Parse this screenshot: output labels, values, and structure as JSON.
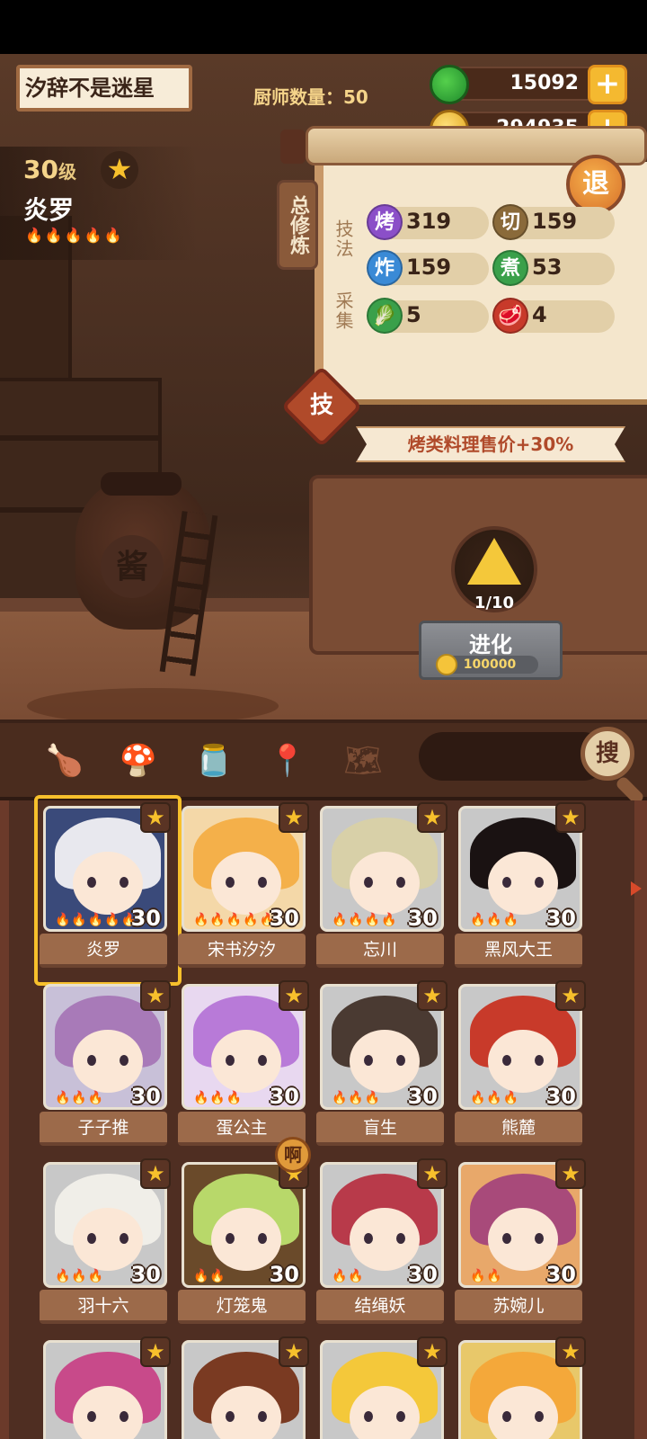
{
  "header": {
    "player_name": "汐辞不是迷星",
    "chef_count_label": "厨师数量：",
    "chef_count_value": "50",
    "jade": "15092",
    "coins": "294935",
    "plus_label": "+"
  },
  "chef": {
    "level": "30",
    "level_suffix": "级",
    "star": "★",
    "name": "炎罗",
    "flames": "🔥🔥🔥🔥🔥"
  },
  "skills": {
    "tab_label": "总修炼",
    "exit_label": "退",
    "technique_label": "技法",
    "gather_label": "采集",
    "items": [
      {
        "badge": "烤",
        "value": "319",
        "color": "#8b4fc8"
      },
      {
        "badge": "切",
        "value": "159",
        "color": "#8a6a3a"
      },
      {
        "badge": "炸",
        "value": "159",
        "color": "#3a8ad6"
      },
      {
        "badge": "煮",
        "value": "53",
        "color": "#3aa04a"
      }
    ],
    "gather": [
      {
        "icon": "vegetable-icon",
        "value": "5",
        "color": "#3aa04a"
      },
      {
        "icon": "meat-icon",
        "value": "4",
        "color": "#c83a2a"
      }
    ],
    "skill_badge": "技",
    "bonus": "烤类料理售价+30%"
  },
  "evolve": {
    "count": "1/10",
    "button_label": "进化",
    "cost": "100000"
  },
  "toolbar": {
    "search_label": "搜",
    "tools": [
      "drumstick-icon",
      "mushroom-icon",
      "jar-icon",
      "location-icon",
      "map-icon"
    ]
  },
  "cards": [
    {
      "name": "炎罗",
      "level": "30",
      "flames": "🔥🔥🔥🔥🔥",
      "hair": "#e8e8ee",
      "bg": "#3a4a7a",
      "selected": true
    },
    {
      "name": "宋书汐汐",
      "level": "30",
      "flames": "🔥🔥🔥🔥🔥",
      "hair": "#f4b04a",
      "bg": "#f4d8a8"
    },
    {
      "name": "忘川",
      "level": "30",
      "flames": "🔥🔥🔥🔥",
      "hair": "#d8d0a8",
      "bg": "#c8c8c8"
    },
    {
      "name": "黑风大王",
      "level": "30",
      "flames": "🔥🔥🔥",
      "hair": "#1a1212",
      "bg": "#c8c8c8"
    },
    {
      "name": "子子推",
      "level": "30",
      "flames": "🔥🔥🔥",
      "hair": "#a87ab8",
      "bg": "#c8c0d8"
    },
    {
      "name": "蛋公主",
      "level": "30",
      "flames": "🔥🔥🔥",
      "hair": "#b87ad8",
      "bg": "#e8d8f0"
    },
    {
      "name": "盲生",
      "level": "30",
      "flames": "🔥🔥🔥",
      "hair": "#4a3a32",
      "bg": "#c8c8c8"
    },
    {
      "name": "熊麓",
      "level": "30",
      "flames": "🔥🔥🔥",
      "hair": "#c83a2a",
      "bg": "#c8c8c8"
    },
    {
      "name": "羽十六",
      "level": "30",
      "flames": "🔥🔥🔥",
      "hair": "#f0eee8",
      "bg": "#c8c8c8"
    },
    {
      "name": "灯笼鬼",
      "level": "30",
      "flames": "🔥🔥",
      "hair": "#b8d86a",
      "bg": "#6a4a2a",
      "warn": "啊"
    },
    {
      "name": "结绳妖",
      "level": "30",
      "flames": "🔥🔥",
      "hair": "#b83a4a",
      "bg": "#c8c8c8"
    },
    {
      "name": "苏婉儿",
      "level": "30",
      "flames": "🔥🔥",
      "hair": "#a84a7a",
      "bg": "#e8a86a"
    },
    {
      "name": "",
      "level": "",
      "flames": "",
      "hair": "#c84a8a",
      "bg": "#c8c8c8"
    },
    {
      "name": "",
      "level": "",
      "flames": "",
      "hair": "#7a3a22",
      "bg": "#c8c8c8"
    },
    {
      "name": "",
      "level": "",
      "flames": "",
      "hair": "#f4c83a",
      "bg": "#c8c8c8"
    },
    {
      "name": "",
      "level": "",
      "flames": "",
      "hair": "#f4a83a",
      "bg": "#e8c86a"
    }
  ]
}
